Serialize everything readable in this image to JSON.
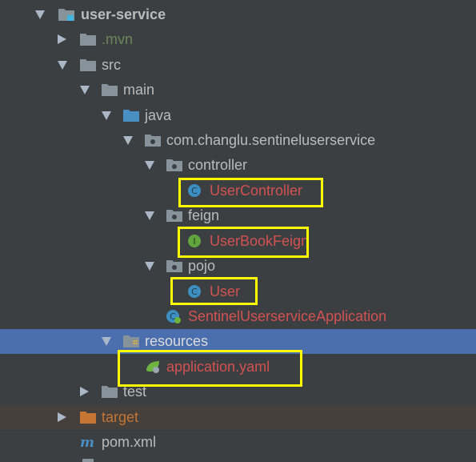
{
  "tree": {
    "items": [
      {
        "label": "user-service"
      },
      {
        "label": ".mvn"
      },
      {
        "label": "src"
      },
      {
        "label": "main"
      },
      {
        "label": "java"
      },
      {
        "label": "com.changlu.sentineluserservice"
      },
      {
        "label": "controller"
      },
      {
        "label": "UserController"
      },
      {
        "label": "feign"
      },
      {
        "label": "UserBookFeign"
      },
      {
        "label": "pojo"
      },
      {
        "label": "User"
      },
      {
        "label": "SentinelUserserviceApplication"
      },
      {
        "label": "resources"
      },
      {
        "label": "application.yaml"
      },
      {
        "label": "test"
      },
      {
        "label": "target"
      },
      {
        "label": "pom.xml"
      }
    ]
  },
  "colors": {
    "background": "#3c3f41",
    "selection": "#4b6eaf",
    "highlight_box": "#ffff00",
    "error_text": "#d25252",
    "excluded_text": "#6a8759",
    "target_text": "#c57633"
  },
  "icons": {
    "folder": "folder-icon",
    "module": "module-folder-icon",
    "package": "package-icon",
    "class": "class-icon",
    "interface": "interface-icon",
    "spring_boot": "spring-boot-app-icon",
    "yaml": "spring-yaml-icon",
    "maven": "maven-icon"
  }
}
